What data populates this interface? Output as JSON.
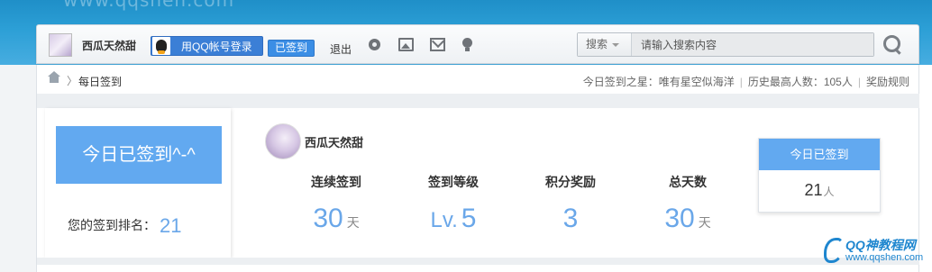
{
  "banner": {
    "faded_url": "www.qqshen.com"
  },
  "topbar": {
    "username": "西瓜天然甜",
    "qq_login_label": "用QQ帐号登录",
    "signed_label": "已签到",
    "logout_label": "退出",
    "icons": [
      "gear-icon",
      "image-icon",
      "mail-icon",
      "bulb-icon"
    ],
    "search": {
      "scope_label": "搜索",
      "placeholder": "请输入搜索内容"
    }
  },
  "breadcrumb": {
    "current": "每日签到",
    "star_label": "今日签到之星：唯有星空似海洋",
    "record_label": "历史最高人数：105人",
    "rules_label": "奖励规则"
  },
  "left_panel": {
    "big_button": "今日已签到^-^",
    "rank_label": "您的签到排名：",
    "rank_value": "21"
  },
  "profile": {
    "username": "西瓜天然甜"
  },
  "stats": [
    {
      "label": "连续签到",
      "prefix": "",
      "value": "30",
      "unit": "天"
    },
    {
      "label": "签到等级",
      "prefix": "Lv.",
      "value": "5",
      "unit": ""
    },
    {
      "label": "积分奖励",
      "prefix": "",
      "value": "3",
      "unit": ""
    },
    {
      "label": "总天数",
      "prefix": "",
      "value": "30",
      "unit": "天"
    }
  ],
  "today_card": {
    "title": "今日已签到",
    "count": "21",
    "unit": "人"
  },
  "watermark": {
    "title": "QQ神教程网",
    "url": "www.qqshen.com"
  },
  "colors": {
    "accent": "#62a9f0",
    "number_blue": "#6aa7e9",
    "banner": "#2c9fd6"
  }
}
